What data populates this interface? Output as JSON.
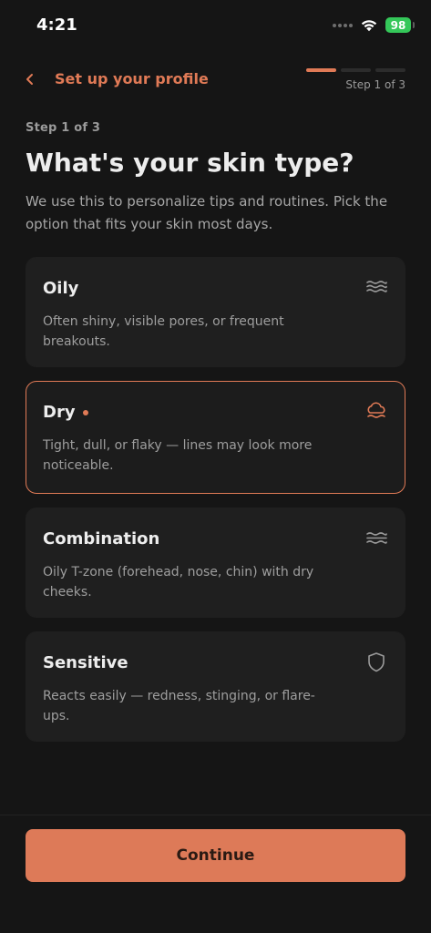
{
  "status_bar": {
    "time": "4:21",
    "battery": "98"
  },
  "header": {
    "title": "Set up your profile",
    "progress_label": "Step 1 of 3",
    "progress": {
      "current": 1,
      "total": 3
    }
  },
  "intro": {
    "eyebrow": "Step 1 of 3",
    "title": "What's your skin type?",
    "subtitle": "We use this to personalize tips and routines. Pick the option that fits your skin most days."
  },
  "options": [
    {
      "title": "Oily",
      "description": "Often shiny, visible pores, or frequent breakouts.",
      "icon": "waves-icon",
      "selected": false
    },
    {
      "title": "Dry",
      "description": "Tight, dull, or flaky — lines may look more noticeable.",
      "icon": "cloud-drop-icon",
      "selected": true
    },
    {
      "title": "Combination",
      "description": "Oily T-zone (forehead, nose, chin) with dry cheeks.",
      "icon": "layers-icon",
      "selected": false
    },
    {
      "title": "Sensitive",
      "description": "Reacts easily — redness, stinging, or flare-ups.",
      "icon": "shield-icon",
      "selected": false
    }
  ],
  "footer": {
    "continue_label": "Continue"
  },
  "colors": {
    "background": "#151515",
    "card": "#1F1F1F",
    "accent": "#E07A56",
    "battery": "#34C759"
  }
}
